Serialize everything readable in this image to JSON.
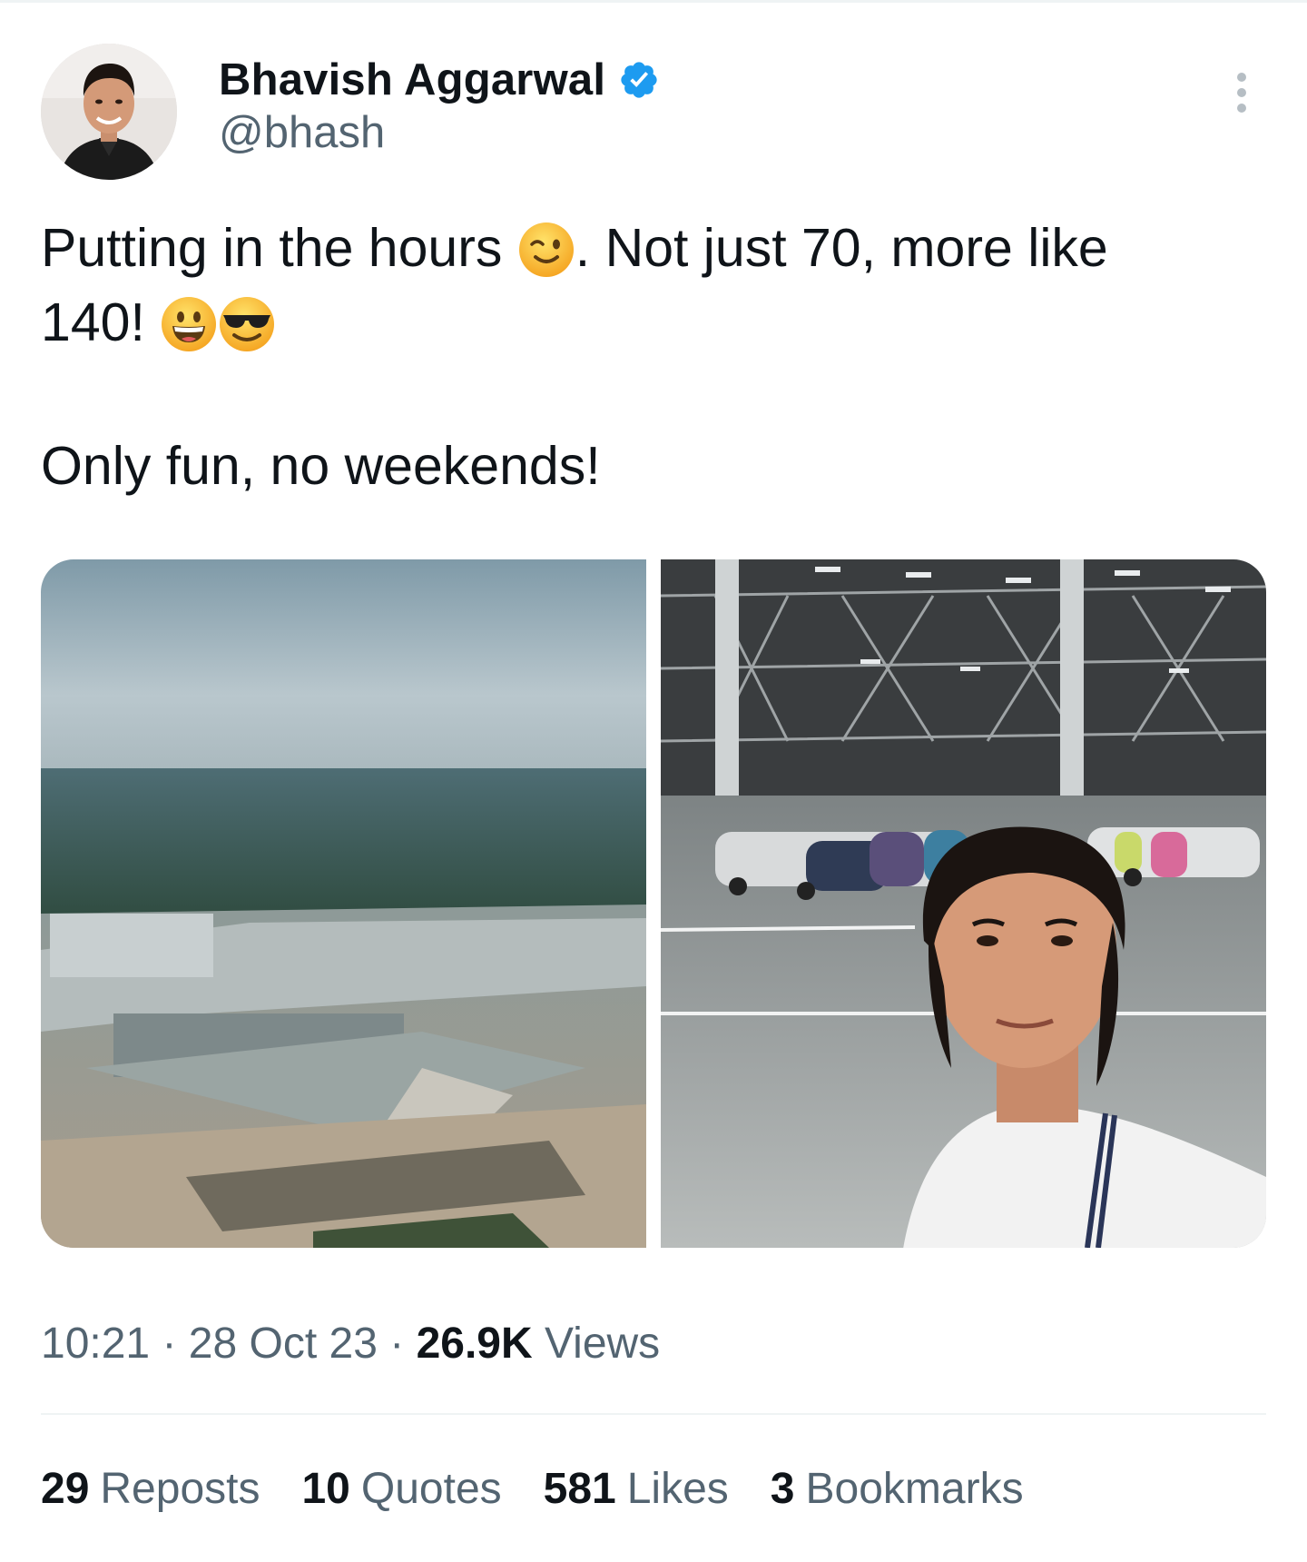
{
  "tweet": {
    "author": {
      "display_name": "Bhavish Aggarwal",
      "handle": "@bhash",
      "verified": true
    },
    "text_line1": "Putting in the hours",
    "text_line1b": ". Not just 70, more like",
    "text_line2": "140!",
    "text_paragraph2": "Only fun, no weekends!",
    "meta": {
      "time": "10:21",
      "separator": " · ",
      "date": "28 Oct 23",
      "views_count": "26.9K",
      "views_label": "Views"
    },
    "stats": [
      {
        "count": "29",
        "label": "Reposts"
      },
      {
        "count": "10",
        "label": "Quotes"
      },
      {
        "count": "581",
        "label": "Likes"
      },
      {
        "count": "3",
        "label": "Bookmarks"
      }
    ]
  },
  "icons": {
    "verified": "verified-badge-icon",
    "more": "more-options-icon",
    "emoji_wink": "winking-face-emoji",
    "emoji_grin": "grinning-face-emoji",
    "emoji_sunglasses": "smiling-face-with-sunglasses-emoji"
  },
  "colors": {
    "text_primary": "#0f1419",
    "text_secondary": "#536471",
    "verified_blue": "#1d9bf0",
    "divider": "#eff3f4"
  }
}
